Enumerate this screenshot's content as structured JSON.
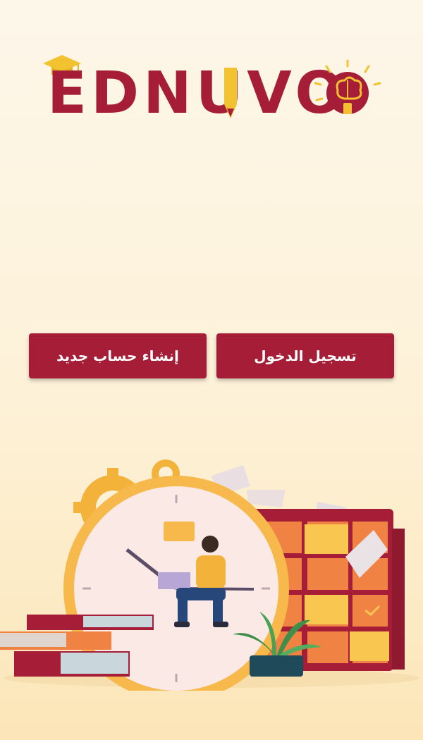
{
  "app": {
    "brand_name": "EDNUVO",
    "logo_colors": {
      "primary": "#a51d36",
      "accent": "#f2c230"
    }
  },
  "buttons": {
    "login_label": "تسجيل الدخول",
    "register_label": "إنشاء حساب جديد"
  },
  "illustration": {
    "description_icon": "student-time-management-illustration"
  }
}
